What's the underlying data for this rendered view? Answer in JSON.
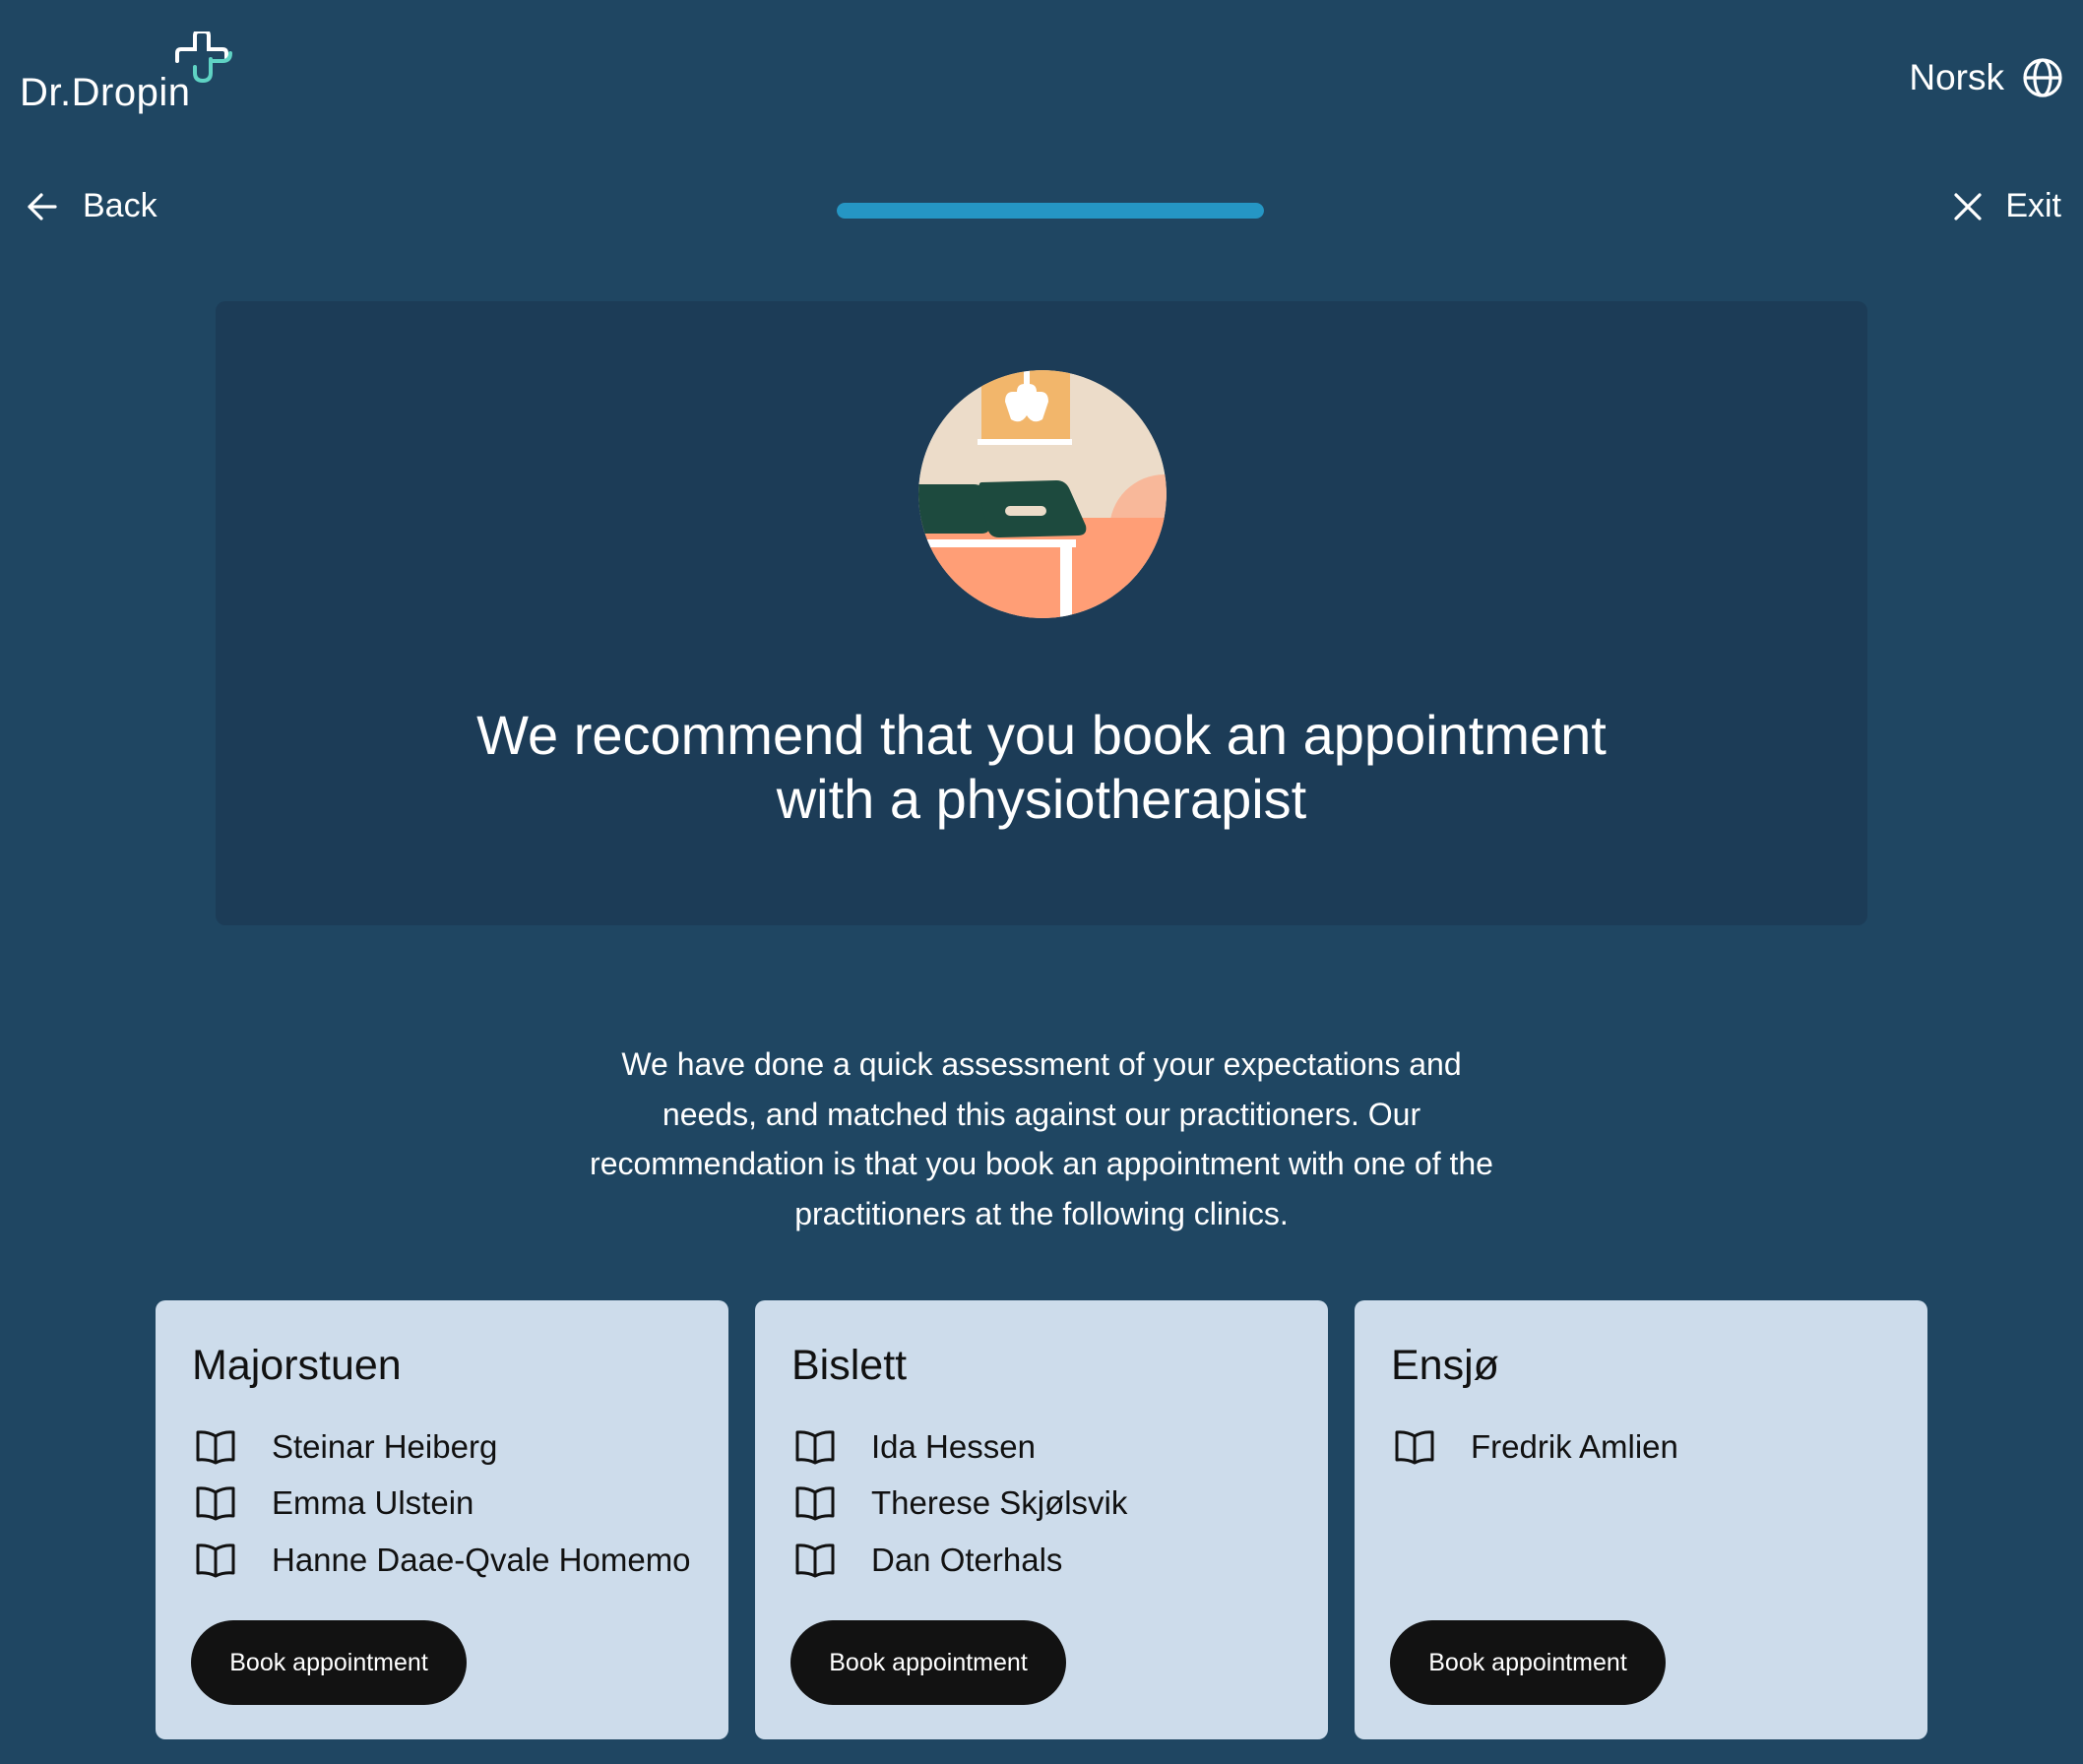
{
  "header": {
    "logo_text": "Dr.Dropin",
    "language_label": "Norsk",
    "back_label": "Back",
    "exit_label": "Exit",
    "progress": 1.0
  },
  "hero": {
    "title_line1": "We recommend that you book an appointment",
    "title_line2": "with a physiotherapist"
  },
  "intro": "We have done a quick assessment of your expectations and needs, and matched this against our practitioners. Our recommendation is that you book an appointment with one of the practitioners at the following clinics.",
  "clinics": [
    {
      "name": "Majorstuen",
      "practitioners": [
        "Steinar Heiberg",
        "Emma Ulstein",
        "Hanne Daae-Qvale Homemo"
      ],
      "button_label": "Book appointment"
    },
    {
      "name": "Bislett",
      "practitioners": [
        "Ida Hessen",
        "Therese Skjølsvik",
        "Dan Oterhals"
      ],
      "button_label": "Book appointment"
    },
    {
      "name": "Ensjø",
      "practitioners": [
        "Fredrik Amlien"
      ],
      "button_label": "Book appointment"
    }
  ],
  "colors": {
    "background": "#1f4662",
    "hero_card": "#1c3c57",
    "progress": "#2596c4",
    "clinic_card": "#cddceb",
    "button": "#121212",
    "logo_accent": "#5fd3c4"
  },
  "icons": {
    "language": "globe-icon",
    "back": "arrow-left-icon",
    "exit": "close-icon",
    "practitioner": "open-book-icon"
  }
}
